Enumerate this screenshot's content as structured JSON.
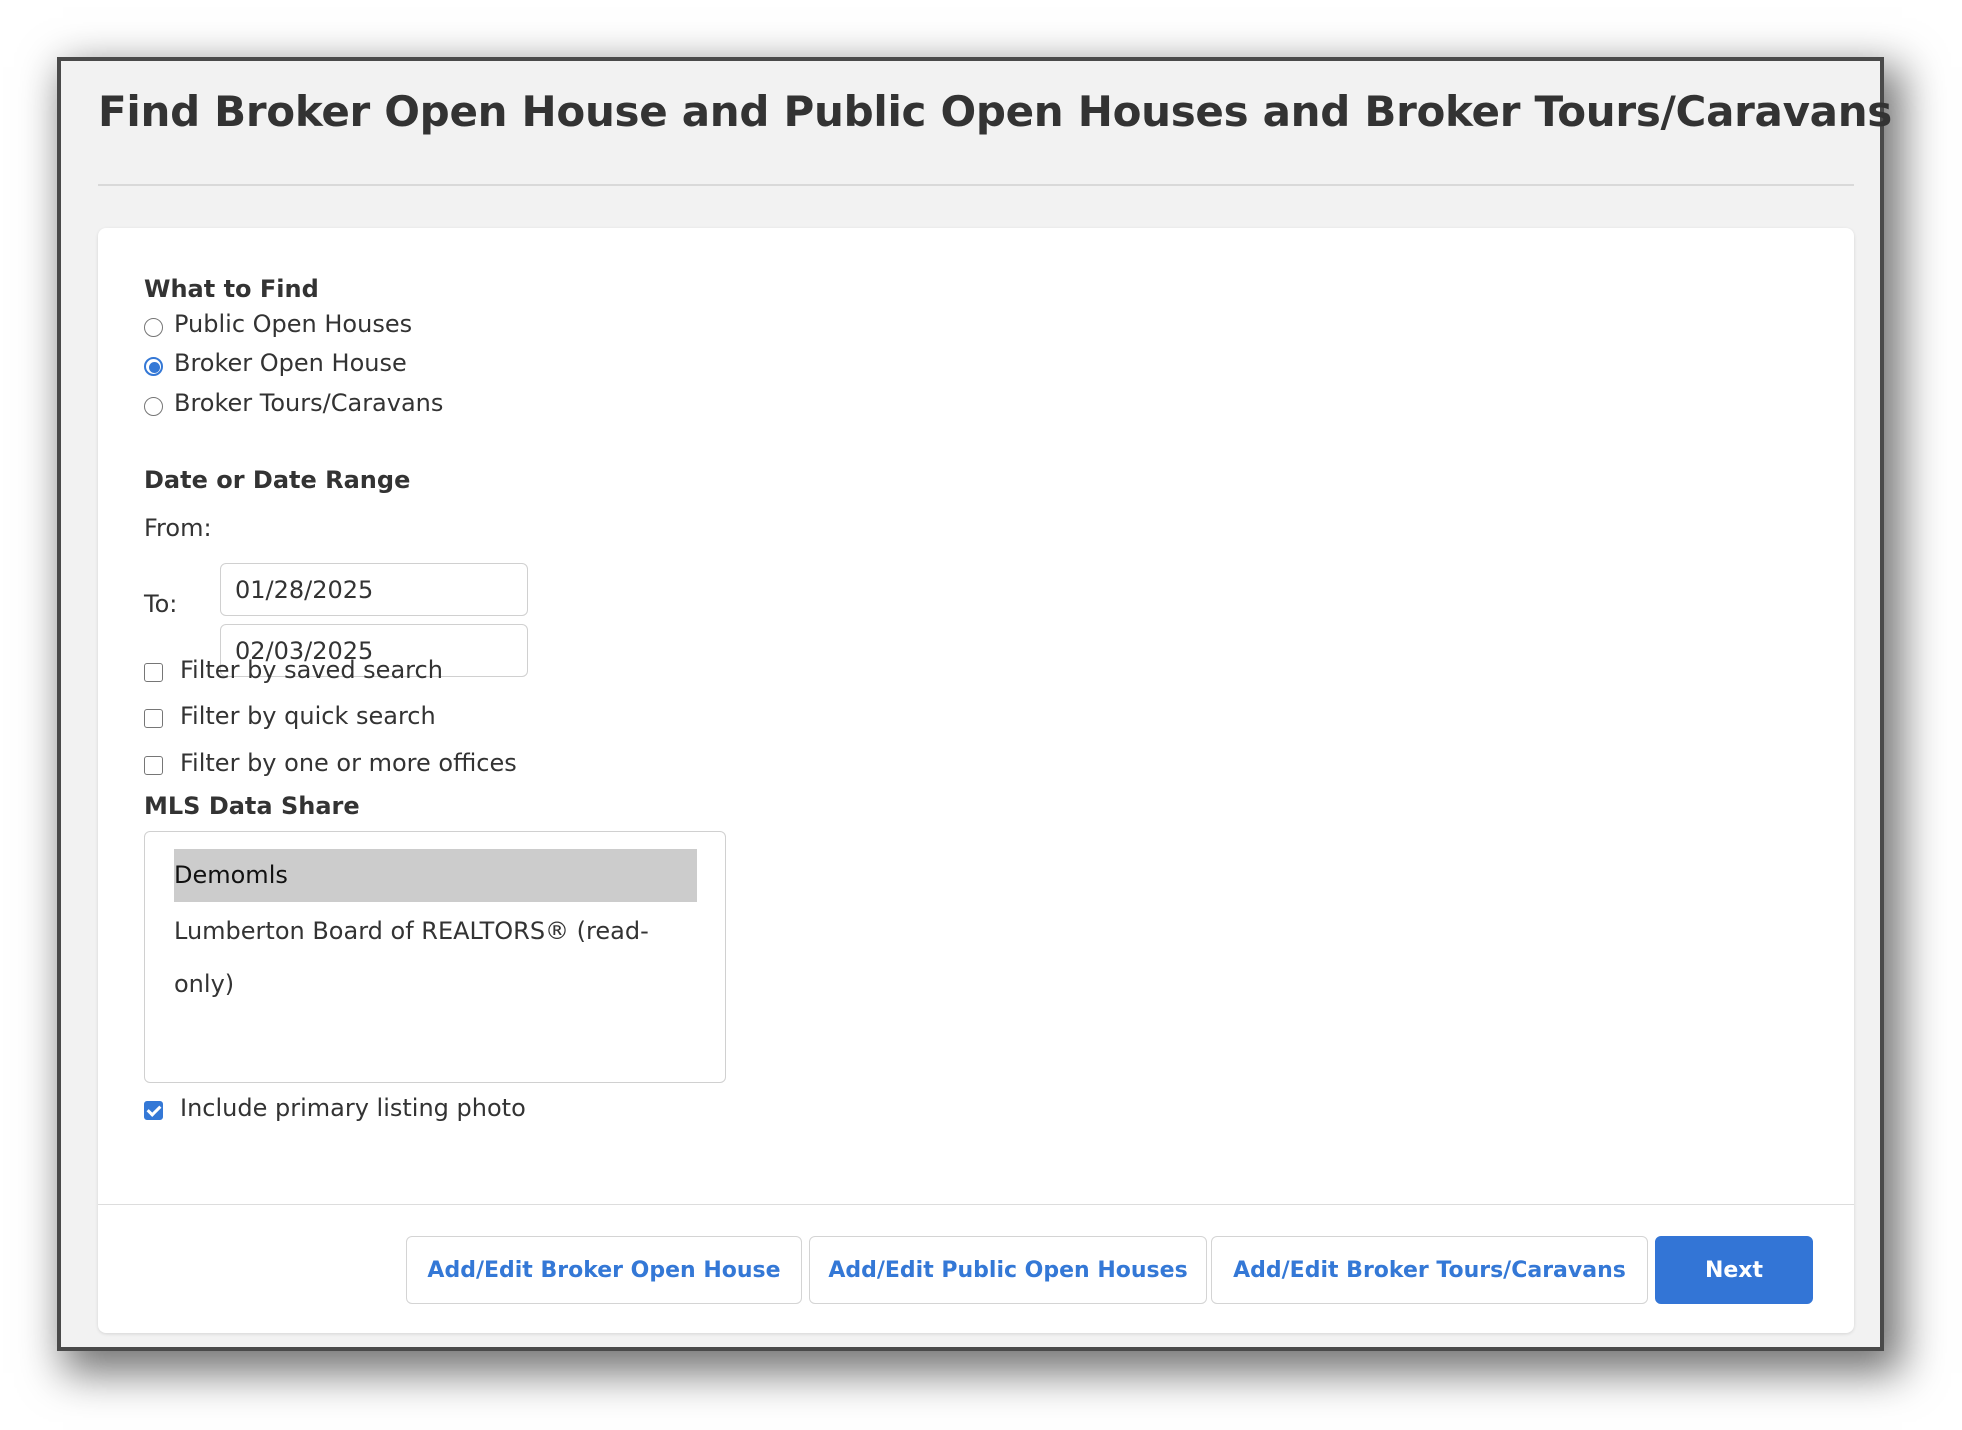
{
  "window": {
    "title": "Find Broker Open House and Public Open Houses and Broker Tours/Caravans"
  },
  "what_to_find": {
    "heading": "What to Find",
    "options": [
      {
        "label": "Public Open Houses",
        "checked": false
      },
      {
        "label": "Broker Open House",
        "checked": true
      },
      {
        "label": "Broker Tours/Caravans",
        "checked": false
      }
    ]
  },
  "date_range": {
    "heading": "Date or Date Range",
    "from_label": "From:",
    "from_value": "01/28/2025",
    "to_label": "To:",
    "to_value": "02/03/2025"
  },
  "filters": [
    {
      "label": "Filter by saved search",
      "checked": false
    },
    {
      "label": "Filter by quick search",
      "checked": false
    },
    {
      "label": "Filter by one or more offices",
      "checked": false
    }
  ],
  "mls_data_share": {
    "heading": "MLS Data Share",
    "options": [
      {
        "label": "Demomls",
        "selected": true
      },
      {
        "label": "Lumberton Board of REALTORS® (read-only)",
        "selected": false
      }
    ]
  },
  "include_photo": {
    "label": "Include primary listing photo",
    "checked": true
  },
  "footer": {
    "buttons": [
      {
        "label": "Add/Edit Broker Open House"
      },
      {
        "label": "Add/Edit Public Open Houses"
      },
      {
        "label": "Add/Edit Broker Tours/Caravans"
      }
    ],
    "next_label": "Next"
  },
  "colors": {
    "accent": "#3375d6",
    "selected_row": "#cccccc",
    "window_bg": "#f2f2f2"
  }
}
